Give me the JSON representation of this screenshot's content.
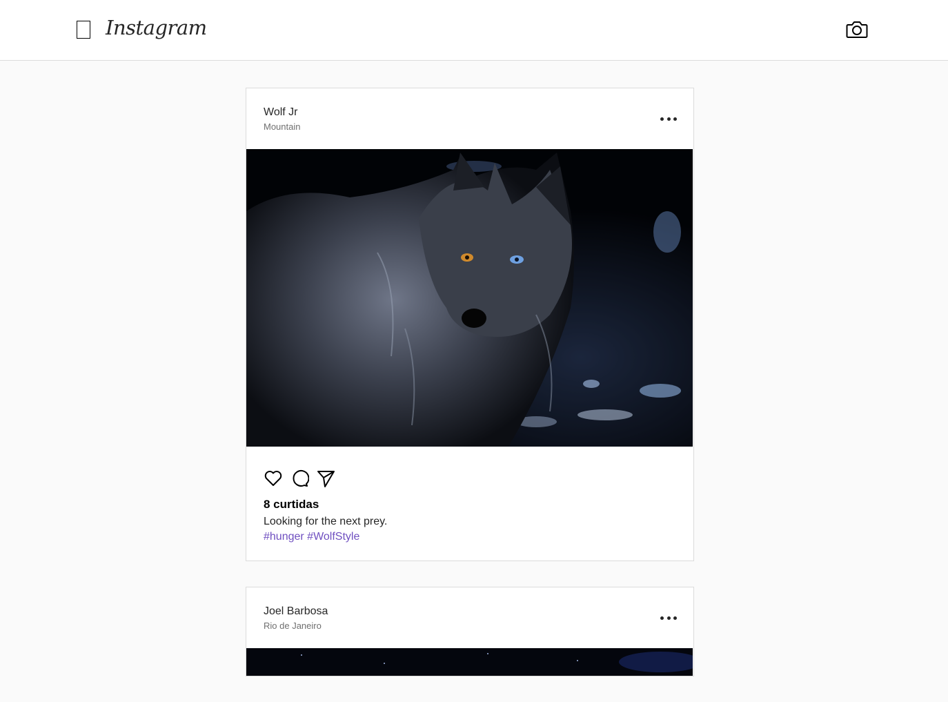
{
  "app": {
    "logo_text": "Instagram"
  },
  "icons": {
    "menu": "menu-icon",
    "camera": "camera-icon",
    "more": "more-options-icon",
    "like": "heart-icon",
    "comment": "comment-icon",
    "share": "send-icon"
  },
  "colors": {
    "header_bg": "#ffffff",
    "page_bg": "#fafafa",
    "border": "#dbdbdb",
    "hashtag": "#6f4fc0"
  },
  "posts": [
    {
      "user": "Wolf Jr",
      "location": "Mountain",
      "likes": "8 curtidas",
      "caption": "Looking for the next prey.",
      "hashtags": [
        "#hunger",
        "#WolfStyle"
      ]
    },
    {
      "user": "Joel Barbosa",
      "location": "Rio de Janeiro"
    }
  ]
}
